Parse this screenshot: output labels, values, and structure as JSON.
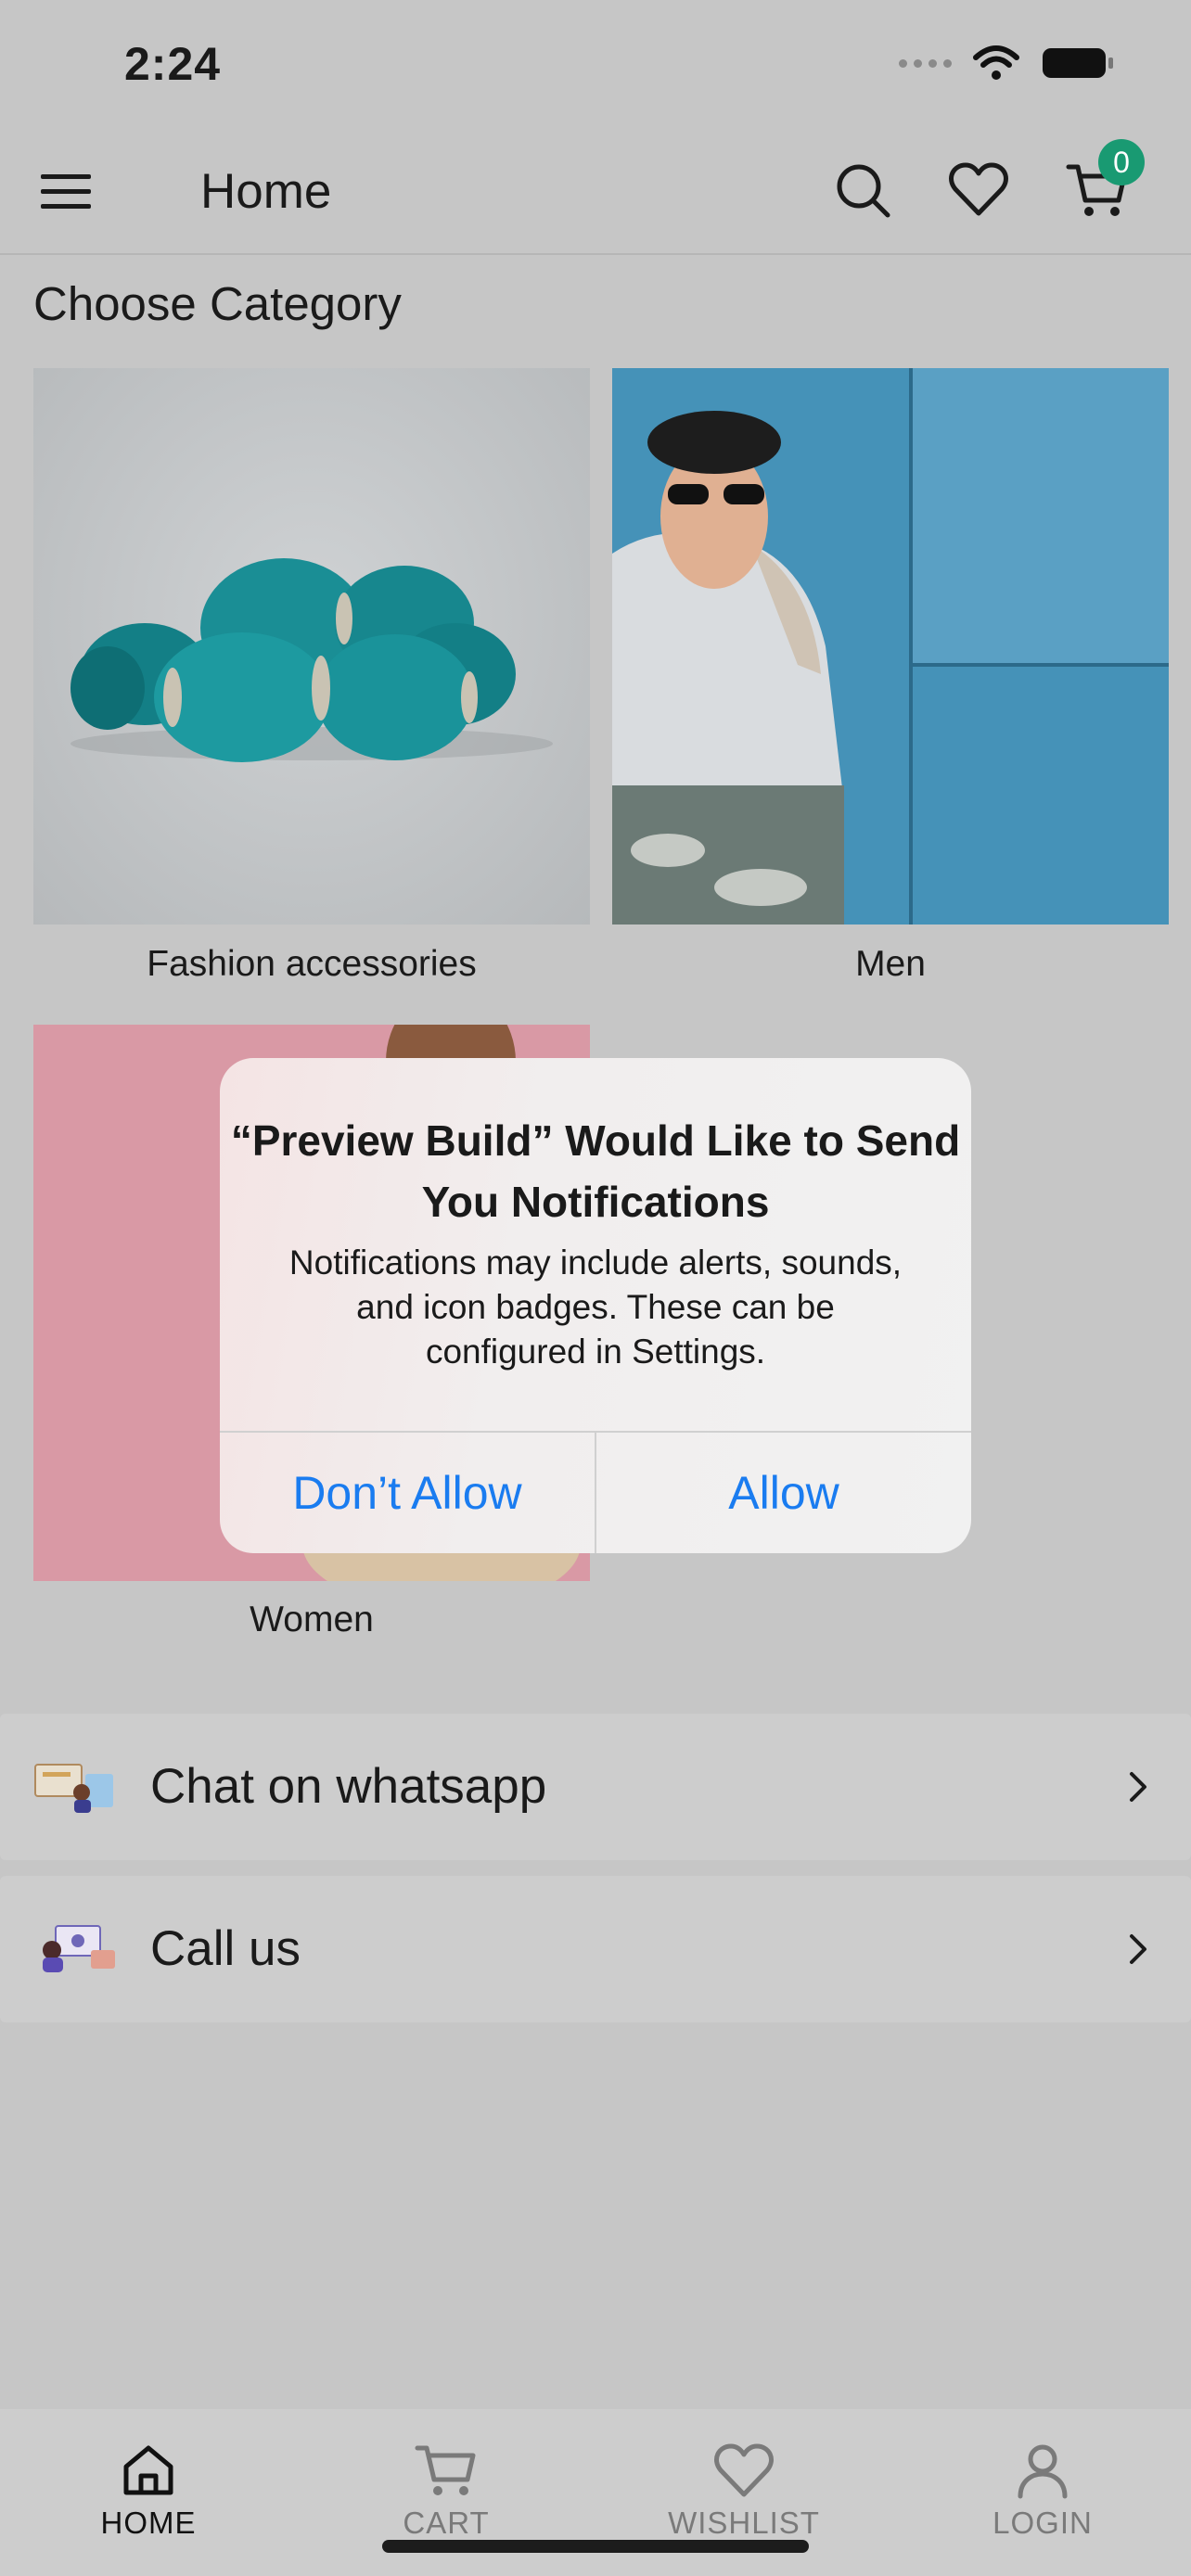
{
  "status_bar": {
    "time": "2:24"
  },
  "header": {
    "title": "Home",
    "cart_count": "0"
  },
  "section": {
    "title": "Choose Category"
  },
  "categories": [
    {
      "label": "Fashion accessories"
    },
    {
      "label": "Men"
    },
    {
      "label": "Women"
    }
  ],
  "contact_rows": [
    {
      "label": "Chat on whatsapp"
    },
    {
      "label": "Call us"
    }
  ],
  "bottom_nav": [
    {
      "label": "HOME"
    },
    {
      "label": "CART"
    },
    {
      "label": "WISHLIST"
    },
    {
      "label": "LOGIN"
    }
  ],
  "alert": {
    "title": "“Preview Build” Would Like to Send You Notifications",
    "message": "Notifications may include alerts, sounds, and icon badges. These can be configured in Settings.",
    "deny_label": "Don’t Allow",
    "allow_label": "Allow"
  },
  "colors": {
    "accent_badge": "#199a72",
    "alert_button": "#1a7cf0"
  }
}
